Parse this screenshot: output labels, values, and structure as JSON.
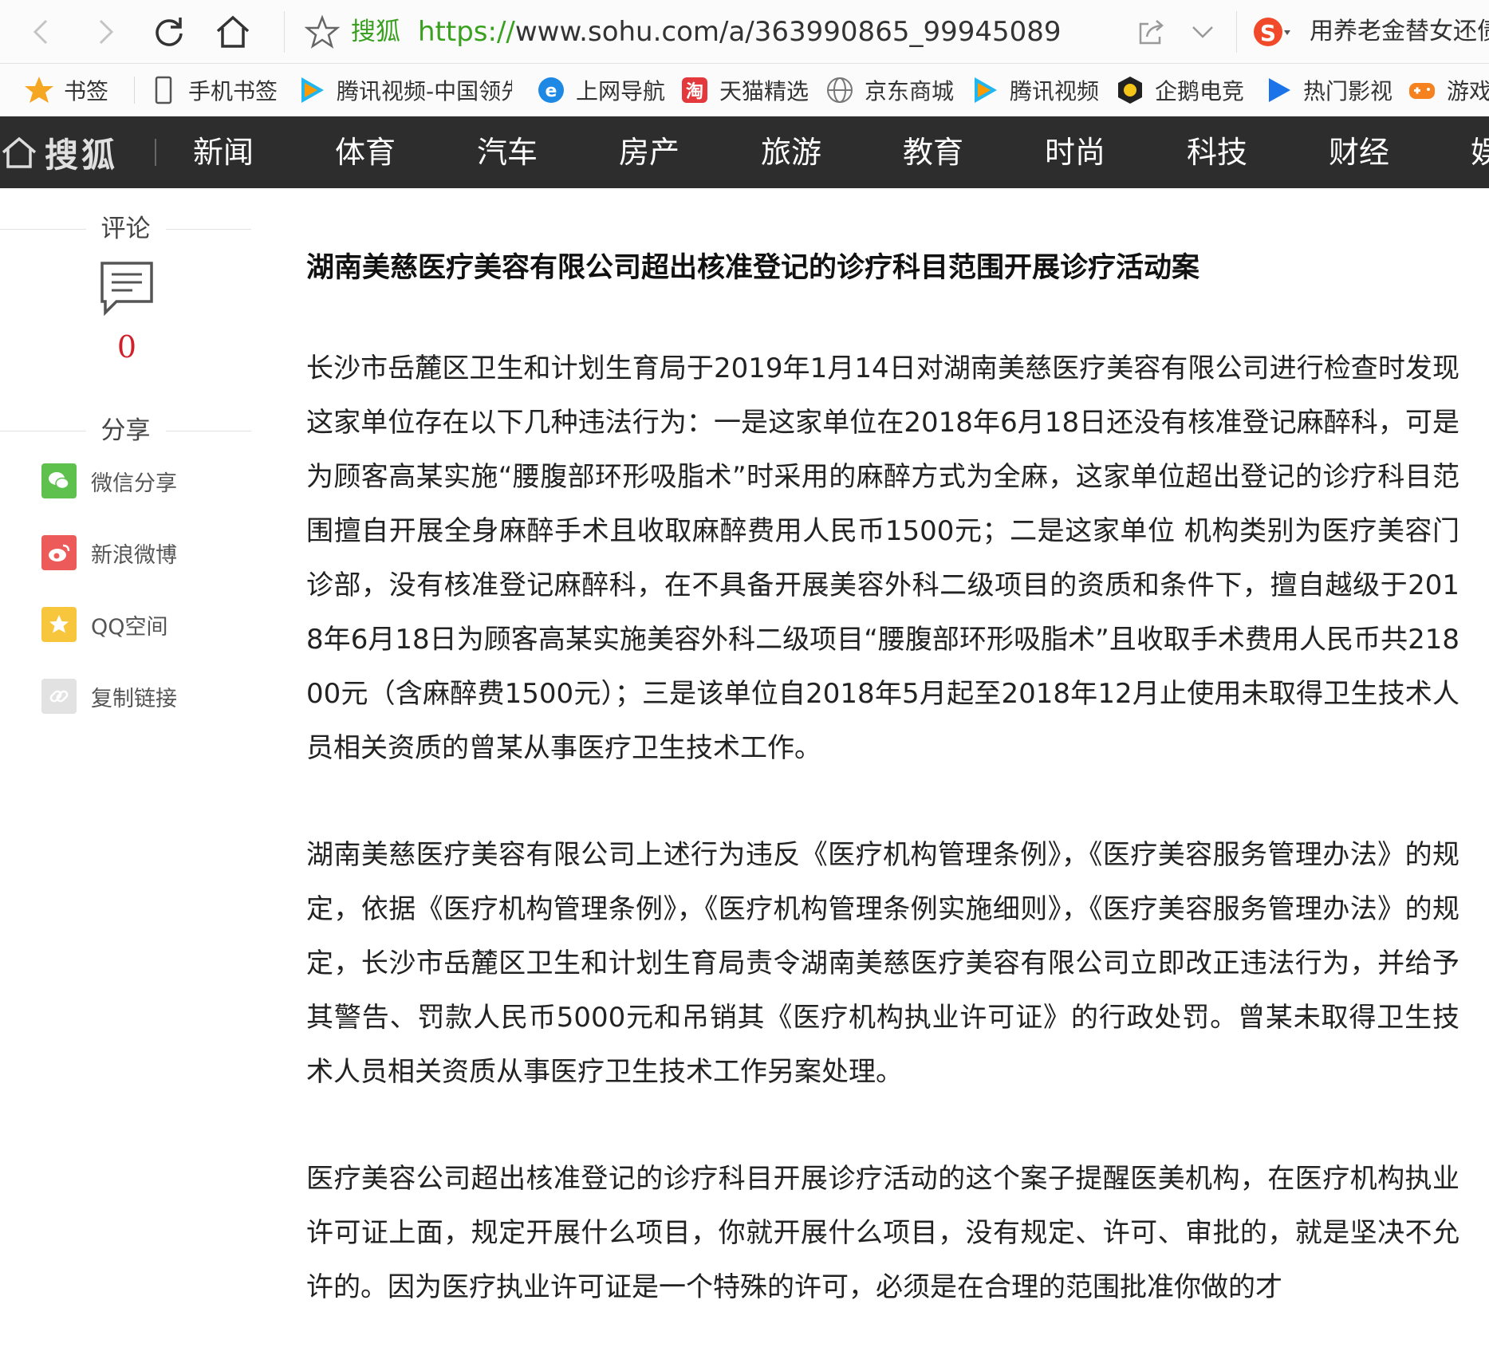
{
  "browser": {
    "site_name": "搜狐",
    "url_scheme": "https://",
    "url_rest": "www.sohu.com/a/363990865_99945089",
    "search_text": "用养老金替女还债"
  },
  "bookmarks": [
    {
      "label": "书签"
    },
    {
      "label": "手机书签"
    },
    {
      "label": "腾讯视频-中国领先"
    },
    {
      "label": "上网导航"
    },
    {
      "label": "天猫精选"
    },
    {
      "label": "京东商城"
    },
    {
      "label": "腾讯视频"
    },
    {
      "label": "企鹅电竞"
    },
    {
      "label": "热门影视"
    },
    {
      "label": "游戏"
    }
  ],
  "nav": {
    "logo": "搜狐",
    "items": [
      "新闻",
      "体育",
      "汽车",
      "房产",
      "旅游",
      "教育",
      "时尚",
      "科技",
      "财经",
      "娱"
    ]
  },
  "sidebar": {
    "comment_title": "评论",
    "comment_count": "0",
    "share_title": "分享",
    "share_items": [
      {
        "label": "微信分享",
        "color": "#5ec14e"
      },
      {
        "label": "新浪微博",
        "color": "#ec5a5a"
      },
      {
        "label": "QQ空间",
        "color": "#f7c63c"
      },
      {
        "label": "复制链接",
        "color": "#e2e2e2"
      }
    ]
  },
  "article": {
    "title": "湖南美慈医疗美容有限公司超出核准登记的诊疗科目范围开展诊疗活动案",
    "paragraphs": [
      "长沙市岳麓区卫生和计划生育局于2019年1月14日对湖南美慈医疗美容有限公司进行检查时发现这家单位存在以下几种违法行为：一是这家单位在2018年6月18日还没有核准登记麻醉科，可是为顾客高某实施“腰腹部环形吸脂术”时采用的麻醉方式为全麻，这家单位超出登记的诊疗科目范围擅自开展全身麻醉手术且收取麻醉费用人民币1500元；二是这家单位 机构类别为医疗美容门诊部，没有核准登记麻醉科，在不具备开展美容外科二级项目的资质和条件下，擅自越级于2018年6月18日为顾客高某实施美容外科二级项目“腰腹部环形吸脂术”且收取手术费用人民币共21800元（含麻醉费1500元）；三是该单位自2018年5月起至2018年12月止使用未取得卫生技术人员相关资质的曾某从事医疗卫生技术工作。",
      "湖南美慈医疗美容有限公司上述行为违反《医疗机构管理条例》，《医疗美容服务管理办法》的规定，依据《医疗机构管理条例》，《医疗机构管理条例实施细则》，《医疗美容服务管理办法》的规定，长沙市岳麓区卫生和计划生育局责令湖南美慈医疗美容有限公司立即改正违法行为，并给予其警告、罚款人民币5000元和吊销其《医疗机构执业许可证》的行政处罚。曾某未取得卫生技术人员相关资质从事医疗卫生技术工作另案处理。",
      "医疗美容公司超出核准登记的诊疗科目开展诊疗活动的这个案子提醒医美机构，在医疗机构执业许可证上面，规定开展什么项目，你就开展什么项目，没有规定、许可、审批的，就是坚决不允许的。因为医疗执业许可证是一个特殊的许可，必须是在合理的范围批准你做的才"
    ]
  }
}
